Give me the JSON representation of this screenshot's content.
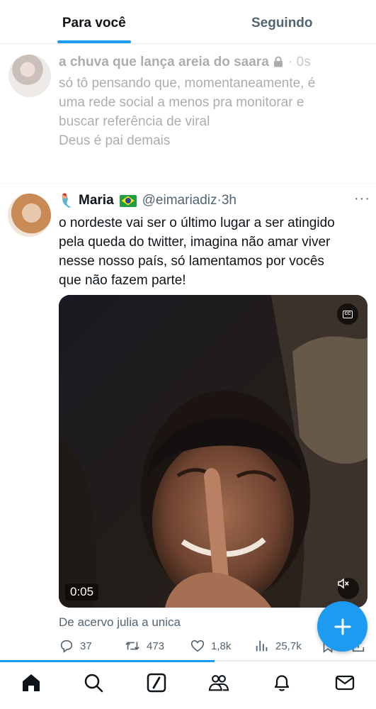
{
  "tabs": [
    {
      "label": "Para você",
      "active": true
    },
    {
      "label": "Seguindo",
      "active": false
    }
  ],
  "post1": {
    "display_name": "a chuva que lança areia do saara",
    "time": "0s",
    "text_lines": [
      "só tô pensando que, momentaneamente, é",
      "uma rede social a menos pra monitorar e",
      "buscar referência de viral",
      "Deus é pai demais"
    ]
  },
  "post2": {
    "display_name": "Maria",
    "handle": "@eimariadiz",
    "time": "3h",
    "text_lines": [
      "o nordeste vai ser o último lugar a ser atingido",
      "pela queda do twitter, imagina não amar viver",
      "nesse nosso país, só lamentamos por vocês",
      "que não fazem parte!"
    ],
    "video": {
      "duration": "0:05",
      "muted": true,
      "captions_button": "CC"
    },
    "from_line": "De acervo julia a unica",
    "stats": {
      "replies": "37",
      "reposts": "473",
      "likes": "1,8k",
      "views": "25,7k"
    }
  },
  "video_progress": 0.57,
  "colors": {
    "accent": "#1d9bf0",
    "text": "#0f1419",
    "muted": "#536471",
    "divider": "#e6ecf0"
  },
  "bottom_nav": [
    "home-icon",
    "search-icon",
    "grok-icon",
    "communities-icon",
    "notifications-icon",
    "messages-icon"
  ]
}
